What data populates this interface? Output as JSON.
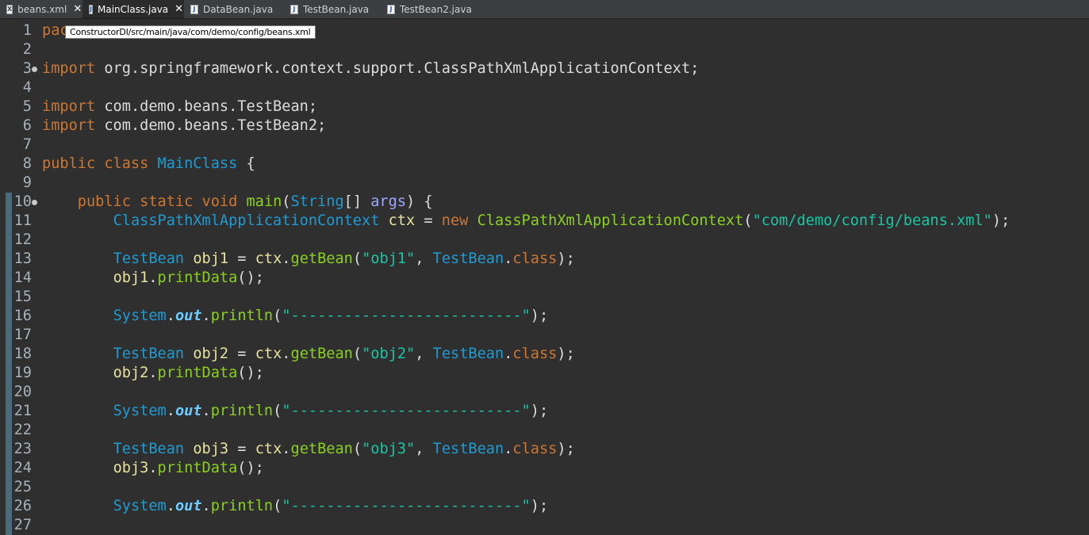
{
  "tabs": [
    {
      "label": "beans.xml",
      "icon": "xml-file-icon",
      "closable": true
    },
    {
      "label": "MainClass.java",
      "icon": "java-file-icon",
      "closable": true,
      "active": true
    },
    {
      "label": "DataBean.java",
      "icon": "java-file-icon",
      "closable": false
    },
    {
      "label": "TestBean.java",
      "icon": "java-file-icon",
      "closable": false
    },
    {
      "label": "TestBean2.java",
      "icon": "java-file-icon",
      "closable": false
    }
  ],
  "tooltip": "ConstructorDI/src/main/java/com/demo/config/beans.xml",
  "lines": [
    {
      "n": "1",
      "t": [
        [
          "kw",
          "pac"
        ]
      ]
    },
    {
      "n": "2",
      "t": []
    },
    {
      "n": "3",
      "fold": true,
      "t": [
        [
          "kw",
          "import"
        ],
        [
          "plain",
          " org.springframework.context.support.ClassPathXmlApplicationContext;"
        ]
      ]
    },
    {
      "n": "4",
      "t": []
    },
    {
      "n": "5",
      "t": [
        [
          "kw",
          "import"
        ],
        [
          "plain",
          " com.demo.beans.TestBean;"
        ]
      ]
    },
    {
      "n": "6",
      "t": [
        [
          "kw",
          "import"
        ],
        [
          "plain",
          " com.demo.beans.TestBean2;"
        ]
      ]
    },
    {
      "n": "7",
      "t": []
    },
    {
      "n": "8",
      "t": [
        [
          "kw",
          "public class "
        ],
        [
          "ty",
          "MainClass"
        ],
        [
          "plain",
          " {"
        ]
      ]
    },
    {
      "n": "9",
      "t": []
    },
    {
      "n": "10",
      "fold": true,
      "mark": true,
      "t": [
        [
          "plain",
          "    "
        ],
        [
          "kw",
          "public static void "
        ],
        [
          "mth",
          "main"
        ],
        [
          "plain",
          "("
        ],
        [
          "ty",
          "String"
        ],
        [
          "plain",
          "[] "
        ],
        [
          "prm",
          "args"
        ],
        [
          "plain",
          ") {"
        ]
      ]
    },
    {
      "n": "11",
      "mark": true,
      "t": [
        [
          "plain",
          "        "
        ],
        [
          "ty",
          "ClassPathXmlApplicationContext"
        ],
        [
          "plain",
          " "
        ],
        [
          "var",
          "ctx"
        ],
        [
          "plain",
          " = "
        ],
        [
          "kw",
          "new "
        ],
        [
          "mth",
          "ClassPathXmlApplicationContext"
        ],
        [
          "plain",
          "("
        ],
        [
          "str",
          "\"com/demo/config/beans.xml\""
        ],
        [
          "plain",
          ");"
        ]
      ]
    },
    {
      "n": "12",
      "mark": true,
      "t": []
    },
    {
      "n": "13",
      "mark": true,
      "t": [
        [
          "plain",
          "        "
        ],
        [
          "ty",
          "TestBean"
        ],
        [
          "plain",
          " "
        ],
        [
          "var",
          "obj1"
        ],
        [
          "plain",
          " = "
        ],
        [
          "var",
          "ctx"
        ],
        [
          "plain",
          "."
        ],
        [
          "mth",
          "getBean"
        ],
        [
          "plain",
          "("
        ],
        [
          "str",
          "\"obj1\""
        ],
        [
          "plain",
          ", "
        ],
        [
          "ty",
          "TestBean"
        ],
        [
          "plain",
          "."
        ],
        [
          "kw",
          "class"
        ],
        [
          "plain",
          ");"
        ]
      ]
    },
    {
      "n": "14",
      "mark": true,
      "t": [
        [
          "plain",
          "        "
        ],
        [
          "var",
          "obj1"
        ],
        [
          "plain",
          "."
        ],
        [
          "mth",
          "printData"
        ],
        [
          "plain",
          "();"
        ]
      ]
    },
    {
      "n": "15",
      "mark": true,
      "t": []
    },
    {
      "n": "16",
      "mark": true,
      "t": [
        [
          "plain",
          "        "
        ],
        [
          "ty",
          "System"
        ],
        [
          "plain",
          "."
        ],
        [
          "fld",
          "out"
        ],
        [
          "plain",
          "."
        ],
        [
          "mth",
          "println"
        ],
        [
          "plain",
          "("
        ],
        [
          "str",
          "\"--------------------------\""
        ],
        [
          "plain",
          ");"
        ]
      ]
    },
    {
      "n": "17",
      "mark": true,
      "t": []
    },
    {
      "n": "18",
      "mark": true,
      "t": [
        [
          "plain",
          "        "
        ],
        [
          "ty",
          "TestBean"
        ],
        [
          "plain",
          " "
        ],
        [
          "var",
          "obj2"
        ],
        [
          "plain",
          " = "
        ],
        [
          "var",
          "ctx"
        ],
        [
          "plain",
          "."
        ],
        [
          "mth",
          "getBean"
        ],
        [
          "plain",
          "("
        ],
        [
          "str",
          "\"obj2\""
        ],
        [
          "plain",
          ", "
        ],
        [
          "ty",
          "TestBean"
        ],
        [
          "plain",
          "."
        ],
        [
          "kw",
          "class"
        ],
        [
          "plain",
          ");"
        ]
      ]
    },
    {
      "n": "19",
      "mark": true,
      "t": [
        [
          "plain",
          "        "
        ],
        [
          "var",
          "obj2"
        ],
        [
          "plain",
          "."
        ],
        [
          "mth",
          "printData"
        ],
        [
          "plain",
          "();"
        ]
      ]
    },
    {
      "n": "20",
      "mark": true,
      "t": []
    },
    {
      "n": "21",
      "mark": true,
      "t": [
        [
          "plain",
          "        "
        ],
        [
          "ty",
          "System"
        ],
        [
          "plain",
          "."
        ],
        [
          "fld",
          "out"
        ],
        [
          "plain",
          "."
        ],
        [
          "mth",
          "println"
        ],
        [
          "plain",
          "("
        ],
        [
          "str",
          "\"--------------------------\""
        ],
        [
          "plain",
          ");"
        ]
      ]
    },
    {
      "n": "22",
      "mark": true,
      "t": []
    },
    {
      "n": "23",
      "mark": true,
      "t": [
        [
          "plain",
          "        "
        ],
        [
          "ty",
          "TestBean"
        ],
        [
          "plain",
          " "
        ],
        [
          "var",
          "obj3"
        ],
        [
          "plain",
          " = "
        ],
        [
          "var",
          "ctx"
        ],
        [
          "plain",
          "."
        ],
        [
          "mth",
          "getBean"
        ],
        [
          "plain",
          "("
        ],
        [
          "str",
          "\"obj3\""
        ],
        [
          "plain",
          ", "
        ],
        [
          "ty",
          "TestBean"
        ],
        [
          "plain",
          "."
        ],
        [
          "kw",
          "class"
        ],
        [
          "plain",
          ");"
        ]
      ]
    },
    {
      "n": "24",
      "mark": true,
      "t": [
        [
          "plain",
          "        "
        ],
        [
          "var",
          "obj3"
        ],
        [
          "plain",
          "."
        ],
        [
          "mth",
          "printData"
        ],
        [
          "plain",
          "();"
        ]
      ]
    },
    {
      "n": "25",
      "mark": true,
      "t": []
    },
    {
      "n": "26",
      "mark": true,
      "t": [
        [
          "plain",
          "        "
        ],
        [
          "ty",
          "System"
        ],
        [
          "plain",
          "."
        ],
        [
          "fld",
          "out"
        ],
        [
          "plain",
          "."
        ],
        [
          "mth",
          "println"
        ],
        [
          "plain",
          "("
        ],
        [
          "str",
          "\"--------------------------\""
        ],
        [
          "plain",
          ");"
        ]
      ]
    },
    {
      "n": "27",
      "mark": true,
      "t": []
    }
  ]
}
